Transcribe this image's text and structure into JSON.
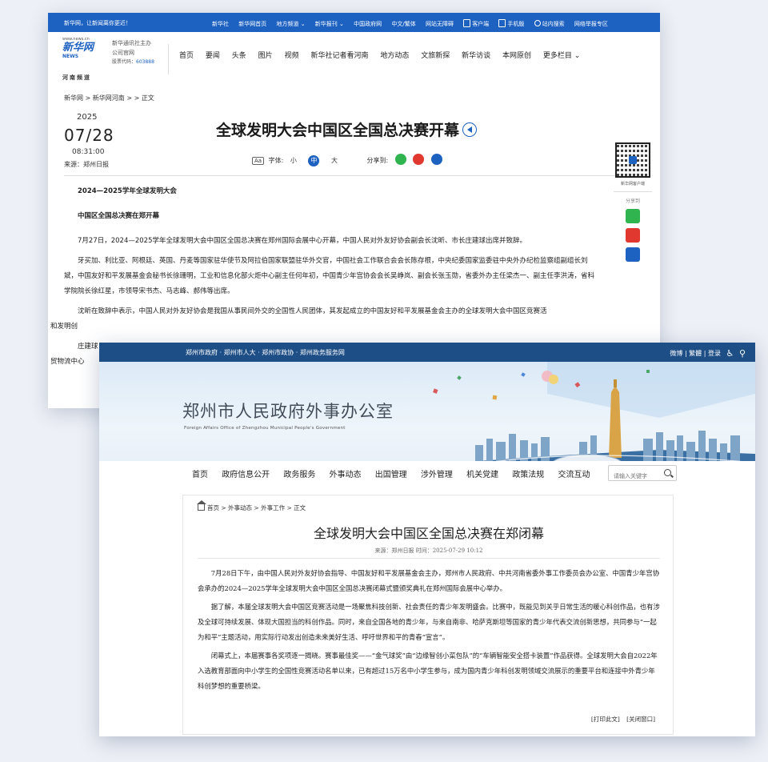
{
  "xinhua": {
    "top_bar": {
      "welcome": "新华网，让新闻离你更近！",
      "links": [
        "新华社",
        "新华网首页",
        "地方频道 ⌄",
        "新华报刊 ⌄",
        "中国政府网",
        "中文/繁体",
        "网站无障碍",
        "客户端",
        "手机版",
        "站内搜索",
        "网络举报专区"
      ]
    },
    "logo": {
      "url": "www.news.cn",
      "name": "新华网",
      "name_en": "NEWS",
      "region": "河南频道"
    },
    "company": {
      "line1": "新华通讯社主办",
      "line2": "公司官网",
      "code_label": "股票代码：",
      "code": "603888"
    },
    "nav": [
      "首页",
      "要闻",
      "头条",
      "图片",
      "视频",
      "新华社记者看河南",
      "地方动态",
      "文旅新探",
      "新华访谈",
      "本网原创",
      "更多栏目 ⌄"
    ],
    "breadcrumb": "新华网 > 新华网河南 > > 正文",
    "date": {
      "year": "2025",
      "month_day": "07/28",
      "time": "08:31:00"
    },
    "source": "来源：郑州日报",
    "title": "全球发明大会中国区全国总决赛开幕",
    "toolbar": {
      "aa": "Aa",
      "font_label": "字体:",
      "small": "小",
      "medium": "中",
      "large": "大",
      "share_label": "分享到:"
    },
    "side": {
      "qr_label": "新华网客户端",
      "share_label": "分享到"
    },
    "article": {
      "headline1": "2024—2025学年全球发明大会",
      "headline2": "中国区全国总决赛在郑开幕",
      "p1": "7月27日，2024—2025学年全球发明大会中国区全国总决赛在郑州国际会展中心开幕，中国人民对外友好协会副会长沈昕、市长庄建球出席并致辞。",
      "p2": "牙买加、利比亚、阿根廷、英国、丹麦等国家驻华使节及阿拉伯国家联盟驻华外交官，中国社会工作联合会会长陈存根，中央纪委国家监委驻中央外办纪检监察组副组长刘斌，中国友好和平发展基金会秘书长徐珊明，工业和信息化部火炬中心副主任何年初，中国青少年宫协会会长吴峥岚、副会长张玉勋，省委外办主任梁杰一、副主任李洪涛，省科学院院长徐红星，市领导宋书杰、马志峰、郝伟等出席。",
      "p3": "沈昕在致辞中表示，中国人民对外友好协会是我国从事民间外交的全国性人民团体，其发起成立的中国友好和平发展基金会主办的全球发明大会中国区竞赛活",
      "p3b": "和发明创",
      "p4": "庄建球",
      "p4b": "贸物流中心"
    }
  },
  "zzfao": {
    "top_bar": {
      "links": "郑州市政府 · 郑州市人大 · 郑州市政协 · 郑州政务服务网",
      "right": "微博 | 繁體 | 登录"
    },
    "banner": {
      "title": "郑州市人民政府外事办公室",
      "title_en": "Foreign Affairs Office of Zhengzhou Municipal People's Government"
    },
    "nav": [
      "首页",
      "政府信息公开",
      "政务服务",
      "外事动态",
      "出国管理",
      "涉外管理",
      "机关党建",
      "政策法规",
      "交流互动"
    ],
    "search_placeholder": "请输入关键字",
    "breadcrumb": "首页 > 外事动态 > 外事工作 > 正文",
    "title": "全球发明大会中国区全国总决赛在郑闭幕",
    "meta": "来源：郑州日报  时间：2025-07-29 10:12",
    "article": {
      "p1": "7月28日下午，由中国人民对外友好协会指导、中国友好和平发展基金会主办，郑州市人民政府、中共河南省委外事工作委员会办公室、中国青少年宫协会承办的2024—2025学年全球发明大会中国区全国总决赛闭幕式暨颁奖典礼在郑州国际会展中心举办。",
      "p2": "据了解，本届全球发明大会中国区竞赛活动是一场聚焦科技创新、社会责任的青少年发明盛会。比赛中，既能见到关乎日常生活的暖心科创作品，也有涉及全球可持续发展、体现大国担当的科创作品。同时，来自全国各地的青少年，与来自南非、哈萨克斯坦等国家的青少年代表交流创新思想，共同参与“一起为和平”主题活动，用实际行动发出创造未来美好生活、呼吁世界和平的青春“宣言”。",
      "p3": "闭幕式上，本届赛事各奖项逐一揭晓。赛事最佳奖——“金气球奖”由“边缘智创小菜包队”的“车辆智能安全搭卡装置”作品获得。全球发明大会自2022年入选教育部面向中小学生的全国性竞赛活动名单以来，已有超过15万名中小学生参与，成为国内青少年科创发明领域交流展示的重要平台和连接中外青少年科创梦想的重要桥梁。"
    },
    "actions": {
      "print": "[打印此文]",
      "close": "[关闭窗口]"
    }
  },
  "colors": {
    "xinhua_blue": "#1d61c1",
    "zz_navy": "#1e4e86",
    "wechat_green": "#2fb450",
    "weibo_red": "#e0372f"
  }
}
